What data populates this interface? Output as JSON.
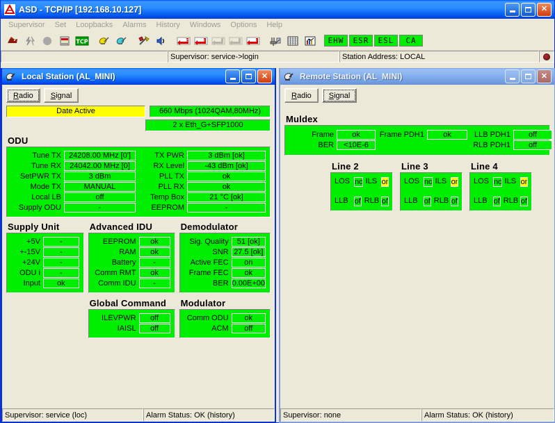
{
  "app": {
    "title": "ASD - TCP/IP [192.168.10.127]",
    "icon": "asd-logo-icon",
    "menu": [
      "Supervisor",
      "Set",
      "Loopbacks",
      "Alarms",
      "History",
      "Windows",
      "Options",
      "Help"
    ],
    "toolbar_icons": [
      "modem-icon",
      "broken-link-icon",
      "circle-icon",
      "equipment-rack-icon",
      "tcp-icon",
      "antenna-yellow-icon",
      "antenna-cyan-icon",
      "tools-icon",
      "speaker-icon",
      "loopback-line-icon",
      "loopback-pdh-icon",
      "loopback-e12-icon",
      "loopback-pdh2-icon",
      "loopback-odu-icon",
      "plug-meter-icon",
      "grid-icon",
      "chart-icon"
    ],
    "status_leds": [
      "EHW",
      "ESR",
      "ESL",
      "CA"
    ],
    "led_color": "#00EE00",
    "statusbar": {
      "supervisor": "Supervisor: service->login",
      "station_address": "Station Address: LOCAL",
      "indicator": "alarm-led-icon"
    }
  },
  "local_window": {
    "title": "Local Station (AL_MINI)",
    "icon": "antenna-icon",
    "tabs": [
      {
        "label": "Radio",
        "accel": "R",
        "active": true
      },
      {
        "label": "Signal",
        "accel": "S",
        "active": false
      }
    ],
    "banner_left": "Date Active",
    "banner_right_1": "660 Mbps (1024QAM,80MHz)",
    "banner_right_2": "2 x Eth_G+SFP1000",
    "banner_left_color": "#FFFF00",
    "banner_right_color": "#00EE00",
    "odu": {
      "title": "ODU",
      "left": [
        {
          "label": "Tune TX",
          "value": "24208.00 MHz  [0']"
        },
        {
          "label": "Tune RX",
          "value": "24042.00 MHz  [0]"
        },
        {
          "label": "SetPWR TX",
          "value": "3 dBm"
        },
        {
          "label": "Mode TX",
          "value": "MANUAL"
        },
        {
          "label": "Local LB",
          "value": "off"
        },
        {
          "label": "Supply ODU",
          "value": "-"
        }
      ],
      "right": [
        {
          "label": "TX PWR",
          "value": "3 dBm [ok]"
        },
        {
          "label": "RX Level",
          "value": "-43 dBm [ok]"
        },
        {
          "label": "PLL TX",
          "value": "ok"
        },
        {
          "label": "PLL RX",
          "value": "ok"
        },
        {
          "label": "Temp Box",
          "value": "21 °C [ok]"
        },
        {
          "label": "EEPROM",
          "value": "-"
        }
      ]
    },
    "supply_unit": {
      "title": "Supply Unit",
      "rows": [
        {
          "label": "+5V",
          "value": "-"
        },
        {
          "label": "+-15V",
          "value": "-"
        },
        {
          "label": "+24V",
          "value": "-"
        },
        {
          "label": "ODU  i",
          "value": "-"
        },
        {
          "label": "Input",
          "value": "ok"
        }
      ]
    },
    "advanced_idu": {
      "title": "Advanced IDU",
      "rows": [
        {
          "label": "EEPROM",
          "value": "ok"
        },
        {
          "label": "RAM",
          "value": "ok"
        },
        {
          "label": "Battery",
          "value": "-"
        },
        {
          "label": "Comm RMT",
          "value": "ok"
        },
        {
          "label": "Comm IDU",
          "value": "-"
        }
      ]
    },
    "demodulator": {
      "title": "Demodulator",
      "rows": [
        {
          "label": "Sig. Quality",
          "value": "51 [ok]"
        },
        {
          "label": "SNR",
          "value": "27.5 [ok]"
        },
        {
          "label": "Active FEC",
          "value": "on"
        },
        {
          "label": "Frame FEC",
          "value": "ok"
        },
        {
          "label": "BER",
          "value": "0.00E+00"
        }
      ]
    },
    "global_command": {
      "title": "Global Command",
      "rows": [
        {
          "label": "ILEVPWR",
          "value": "off"
        },
        {
          "label": "IAISL",
          "value": "off"
        }
      ]
    },
    "modulator": {
      "title": "Modulator",
      "rows": [
        {
          "label": "Comm ODU",
          "value": "ok"
        },
        {
          "label": "ACM",
          "value": "off"
        }
      ]
    },
    "statusbar": {
      "supervisor": "Supervisor: service (loc)",
      "alarm": "Alarm Status: OK (history)"
    }
  },
  "remote_window": {
    "title": "Remote Station (AL_MINI)",
    "icon": "antenna-icon",
    "tabs": [
      {
        "label": "Radio",
        "accel": "R",
        "active": false
      },
      {
        "label": "Signal",
        "accel": "S",
        "active": true
      }
    ],
    "muldex": {
      "title": "Muldex",
      "col1": [
        {
          "label": "Frame",
          "value": "ok"
        },
        {
          "label": "BER",
          "value": "<10E-6"
        }
      ],
      "col2": [
        {
          "label": "Frame PDH1",
          "value": "ok"
        }
      ],
      "col3": [
        {
          "label": "LLB PDH1",
          "value": "off"
        },
        {
          "label": "RLB PDH1",
          "value": "off"
        }
      ]
    },
    "lines": [
      {
        "title": "Line 2",
        "top": [
          {
            "label": "LOS",
            "value": "not",
            "highlight": false
          },
          {
            "label": "ILS",
            "value": "on",
            "highlight": true
          }
        ],
        "bottom": [
          {
            "label": "LLB",
            "value": "off",
            "highlight": false
          },
          {
            "label": "RLB",
            "value": "off",
            "highlight": false
          }
        ]
      },
      {
        "title": "Line 3",
        "top": [
          {
            "label": "LOS",
            "value": "not",
            "highlight": false
          },
          {
            "label": "ILS",
            "value": "on",
            "highlight": true
          }
        ],
        "bottom": [
          {
            "label": "LLB",
            "value": "off",
            "highlight": false
          },
          {
            "label": "RLB",
            "value": "off",
            "highlight": false
          }
        ]
      },
      {
        "title": "Line 4",
        "top": [
          {
            "label": "LOS",
            "value": "not",
            "highlight": false
          },
          {
            "label": "ILS",
            "value": "on",
            "highlight": true
          }
        ],
        "bottom": [
          {
            "label": "LLB",
            "value": "off",
            "highlight": false
          },
          {
            "label": "RLB",
            "value": "off",
            "highlight": false
          }
        ]
      }
    ],
    "statusbar": {
      "supervisor": "Supervisor: none",
      "alarm": "Alarm Status: OK (history)"
    }
  }
}
